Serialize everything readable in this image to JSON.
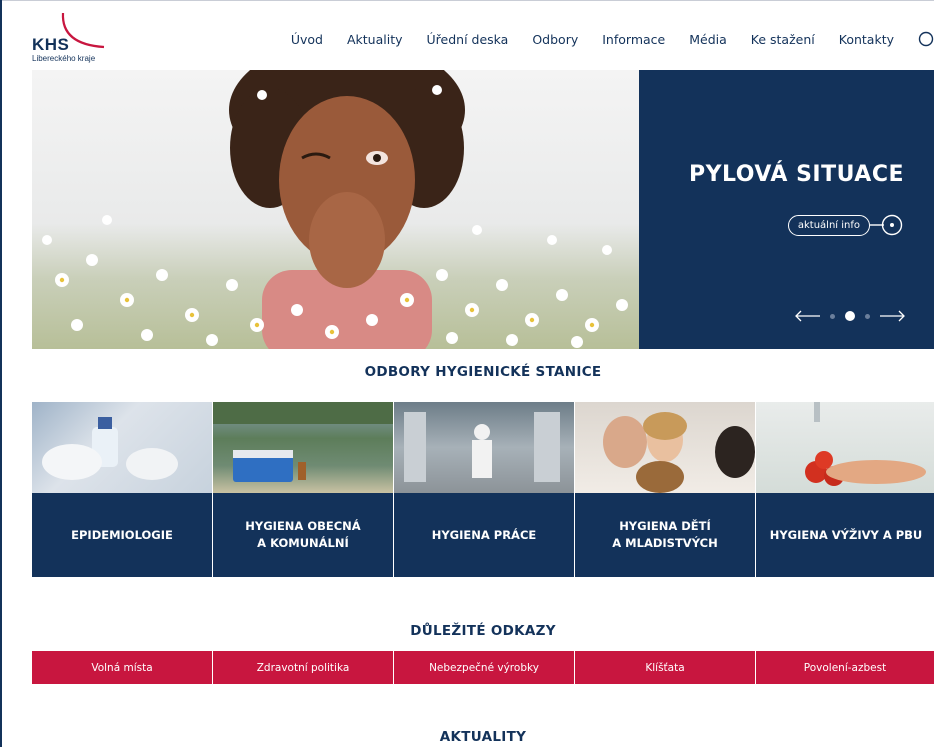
{
  "brand": {
    "logo_text": "KHS",
    "logo_subtitle": "Libereckého kraje"
  },
  "nav": {
    "items": [
      "Úvod",
      "Aktuality",
      "Úřední deska",
      "Odbory",
      "Informace",
      "Média",
      "Ke stažení",
      "Kontakty"
    ],
    "search_icon": "search-icon"
  },
  "hero": {
    "title": "PYLOVÁ SITUACE",
    "cta_label": "aktuální info",
    "slide_count": 3,
    "active_slide": 2
  },
  "departments": {
    "heading": "ODBORY HYGIENICKÉ STANICE",
    "items": [
      {
        "label": "EPIDEMIOLOGIE"
      },
      {
        "label": "HYGIENA OBECNÁ\nA KOMUNÁLNÍ"
      },
      {
        "label": "HYGIENA PRÁCE"
      },
      {
        "label": "HYGIENA DĚTÍ\nA MLADISTVÝCH"
      },
      {
        "label": "HYGIENA VÝŽIVY A PBU"
      }
    ]
  },
  "links": {
    "heading": "DŮLEŽITÉ ODKAZY",
    "items": [
      "Volná místa",
      "Zdravotní politika",
      "Nebezpečné výrobky",
      "Klíšťata",
      "Povolení-azbest"
    ]
  },
  "news": {
    "heading": "AKTUALITY"
  },
  "colors": {
    "navy": "#13325a",
    "crimson": "#c8163f",
    "logo_accent": "#c8163f"
  }
}
